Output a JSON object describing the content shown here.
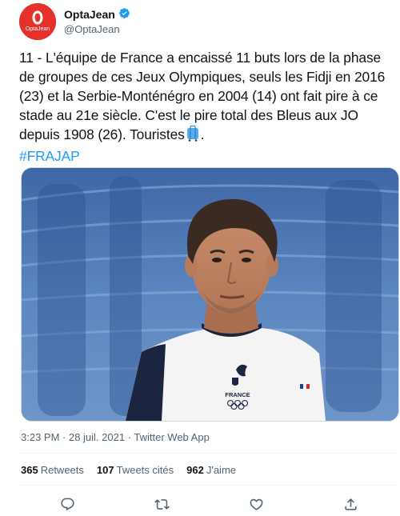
{
  "author": {
    "display_name": "OptaJean",
    "handle": "@OptaJean",
    "verified": true,
    "avatar_text": "OptaJean",
    "avatar_color": "#e4312b"
  },
  "tweet": {
    "text_main": "11 - L'équipe de France a encaissé 11 buts lors de la phase de groupes de ces Jeux Olympiques, seuls les Fidji en 2016 (23) et la Serbie-Monténégro en 2004 (14) ont fait pire à ce stade au 21e siècle. C'est le pire total des Bleus aux JO depuis 1908 (26). Touristes",
    "emoji": "suitcase",
    "text_end": ".",
    "hashtag": "#FRAJAP",
    "link_color": "#1d9bf0"
  },
  "media": {
    "jersey_text": "FRANCE"
  },
  "meta": {
    "timestamp": "3:23 PM · 28 juil. 2021 · Twitter Web App"
  },
  "stats": {
    "retweets_count": "365",
    "retweets_label": "Retweets",
    "quotes_count": "107",
    "quotes_label": "Tweets cités",
    "likes_count": "962",
    "likes_label": "J'aime"
  },
  "actions": {
    "icons": [
      "reply-icon",
      "retweet-icon",
      "like-icon",
      "share-icon"
    ]
  }
}
